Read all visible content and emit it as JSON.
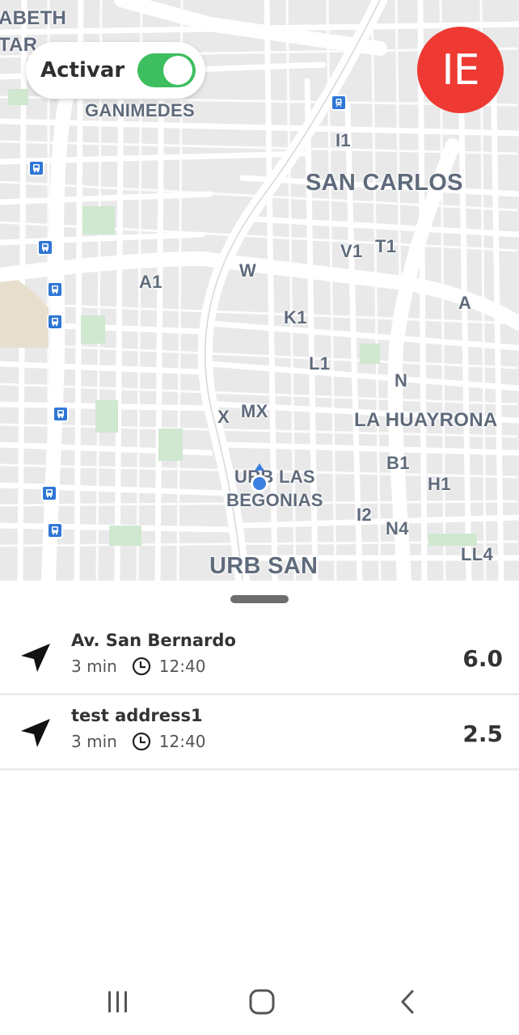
{
  "toggle": {
    "label": "Activar",
    "on": true
  },
  "avatar": {
    "initials": "IE",
    "color": "#ee3a32"
  },
  "map": {
    "labels": [
      {
        "id": "abeth",
        "text": "ABETH"
      },
      {
        "id": "tar",
        "text": "TAR"
      },
      {
        "id": "ganimedes",
        "text": "GANIMEDES"
      },
      {
        "id": "i1",
        "text": "I1"
      },
      {
        "id": "san-carlos",
        "text": "SAN CARLOS"
      },
      {
        "id": "v1",
        "text": "V1"
      },
      {
        "id": "t1",
        "text": "T1"
      },
      {
        "id": "w",
        "text": "W"
      },
      {
        "id": "a1",
        "text": "A1"
      },
      {
        "id": "a",
        "text": "A"
      },
      {
        "id": "k1",
        "text": "K1"
      },
      {
        "id": "l1",
        "text": "L1"
      },
      {
        "id": "n",
        "text": "N"
      },
      {
        "id": "x",
        "text": "X"
      },
      {
        "id": "mx",
        "text": "MX"
      },
      {
        "id": "la-huayrona",
        "text": "LA HUAYRONA"
      },
      {
        "id": "b1",
        "text": "B1"
      },
      {
        "id": "urb-las",
        "text": "URB LAS"
      },
      {
        "id": "begonias",
        "text": "BEGONIAS"
      },
      {
        "id": "h1",
        "text": "H1"
      },
      {
        "id": "i2",
        "text": "I2"
      },
      {
        "id": "n4",
        "text": "N4"
      },
      {
        "id": "ll4",
        "text": "LL4"
      },
      {
        "id": "urb-san",
        "text": "URB SAN"
      }
    ]
  },
  "routes": [
    {
      "title": "Av. San Bernardo",
      "duration": "3 min",
      "time": "12:40",
      "distance": "6.0"
    },
    {
      "title": "test address1",
      "duration": "3 min",
      "time": "12:40",
      "distance": "2.5"
    }
  ],
  "colors": {
    "accent_green": "#3dbe5f",
    "user_location": "#3d7fe0",
    "bus_stop": "#2f77d6"
  }
}
